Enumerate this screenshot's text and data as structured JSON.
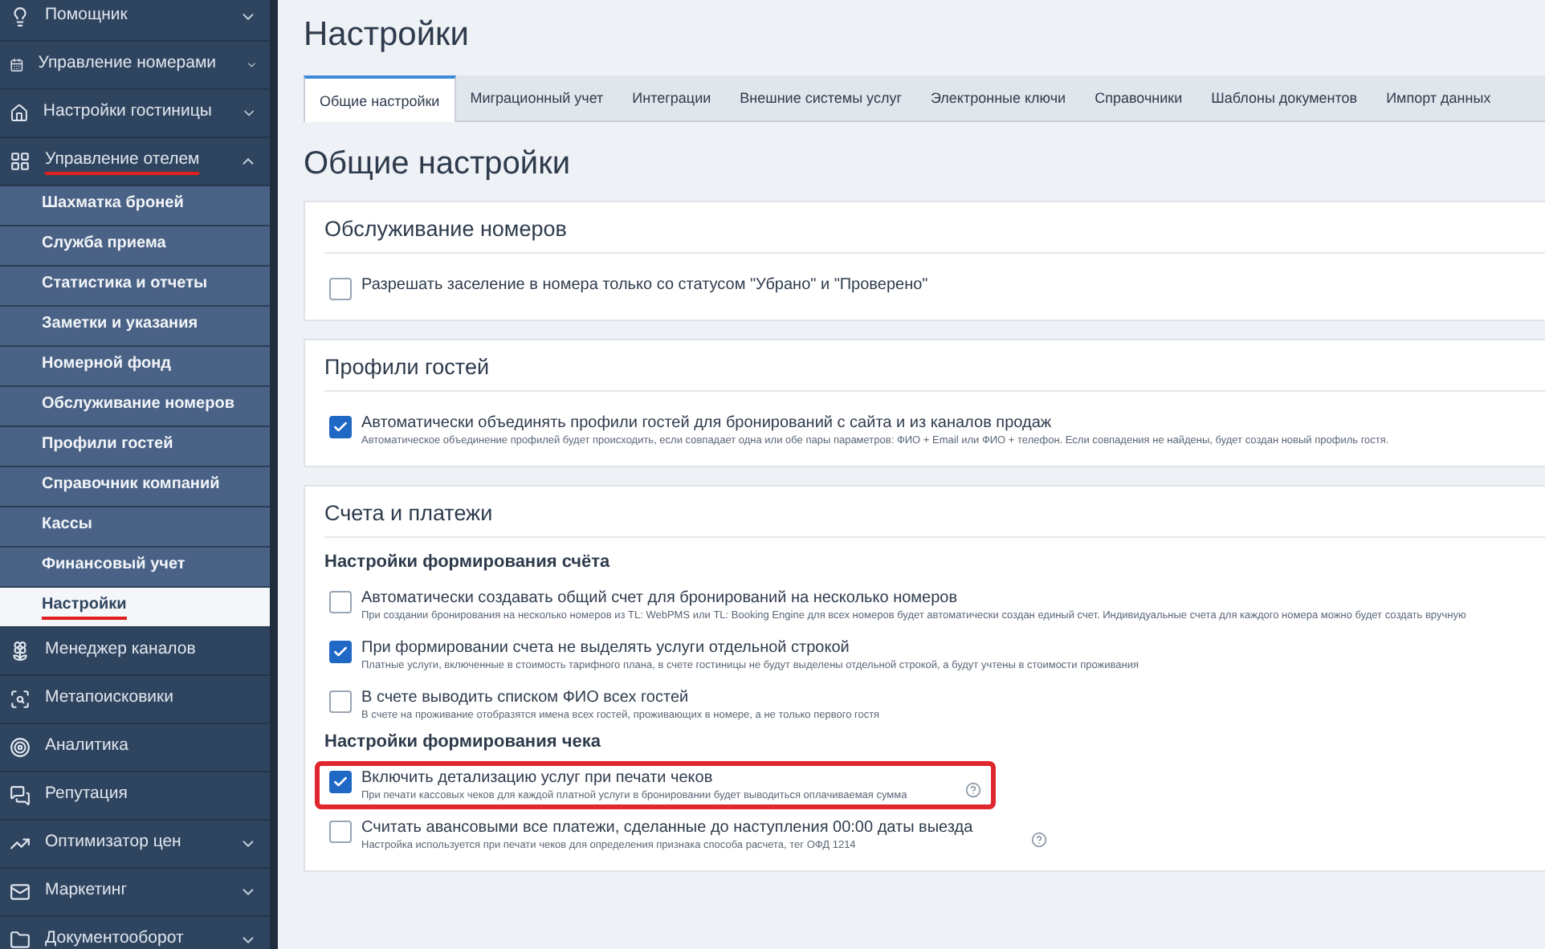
{
  "sidebar": {
    "items": [
      {
        "label": "Помощник",
        "expanded": false,
        "underlined": false
      },
      {
        "label": "Управление номерами",
        "expanded": false,
        "underlined": false
      },
      {
        "label": "Настройки гостиницы",
        "expanded": false,
        "underlined": false
      },
      {
        "label": "Управление отелем",
        "expanded": true,
        "underlined": true,
        "children": [
          {
            "label": "Шахматка броней",
            "selected": false,
            "underlined": false
          },
          {
            "label": "Служба приема",
            "selected": false,
            "underlined": false
          },
          {
            "label": "Статистика и отчеты",
            "selected": false,
            "underlined": false
          },
          {
            "label": "Заметки и указания",
            "selected": false,
            "underlined": false
          },
          {
            "label": "Номерной фонд",
            "selected": false,
            "underlined": false
          },
          {
            "label": "Обслуживание номеров",
            "selected": false,
            "underlined": false
          },
          {
            "label": "Профили гостей",
            "selected": false,
            "underlined": false
          },
          {
            "label": "Справочник компаний",
            "selected": false,
            "underlined": false
          },
          {
            "label": "Кассы",
            "selected": false,
            "underlined": false
          },
          {
            "label": "Финансовый учет",
            "selected": false,
            "underlined": false
          },
          {
            "label": "Настройки",
            "selected": true,
            "underlined": true
          }
        ]
      },
      {
        "label": "Менеджер каналов",
        "underlined": false
      },
      {
        "label": "Метапоисковики",
        "underlined": false
      },
      {
        "label": "Аналитика",
        "underlined": false
      },
      {
        "label": "Репутация",
        "underlined": false
      },
      {
        "label": "Оптимизатор цен",
        "expanded": false,
        "underlined": false
      },
      {
        "label": "Маркетинг",
        "expanded": false,
        "underlined": false
      },
      {
        "label": "Документооборот",
        "expanded": false,
        "underlined": false
      }
    ]
  },
  "page_title": "Настройки",
  "tabs": [
    {
      "label": "Общие настройки",
      "selected": true
    },
    {
      "label": "Миграционный учет",
      "selected": false
    },
    {
      "label": "Интеграции",
      "selected": false
    },
    {
      "label": "Внешние системы услуг",
      "selected": false
    },
    {
      "label": "Электронные ключи",
      "selected": false
    },
    {
      "label": "Справочники",
      "selected": false
    },
    {
      "label": "Шаблоны документов",
      "selected": false
    },
    {
      "label": "Импорт данных",
      "selected": false
    }
  ],
  "section_title": "Общие настройки",
  "cards": [
    {
      "title": "Обслуживание номеров",
      "groups": [
        {
          "options": [
            {
              "label": "Разрешать заселение в номера только со статусом \"Убрано\" и \"Проверено\"",
              "checked": false
            }
          ]
        }
      ]
    },
    {
      "title": "Профили гостей",
      "groups": [
        {
          "options": [
            {
              "label": "Автоматически объединять профили гостей для бронирований с сайта и из каналов продаж",
              "hint": "Автоматическое объединение профилей будет происходить, если совпадает одна или обе пары параметров: ФИО + Email или ФИО + телефон. Если совпадения не найдены, будет создан новый профиль гостя.",
              "checked": true
            }
          ]
        }
      ]
    },
    {
      "title": "Счета и платежи",
      "groups": [
        {
          "subtitle": "Настройки формирования счёта",
          "options": [
            {
              "label": "Автоматически создавать общий счет для бронирований на несколько номеров",
              "hint": "При создании бронирования на несколько номеров из TL: WebPMS или TL: Booking Engine для всех номеров будет автоматически создан единый счет. Индивидуальные счета для каждого номера можно будет создать вручную",
              "checked": false
            },
            {
              "label": "При формировании счета не выделять услуги отдельной строкой",
              "hint": "Платные услуги, включенные в стоимость тарифного плана, в счете гостиницы не будут выделены отдельной строкой, а будут учтены в стоимости проживания",
              "checked": true
            },
            {
              "label": "В счете выводить списком ФИО всех гостей",
              "hint": "В счете на проживание отобразятся имена всех гостей, проживающих в номере, а не только первого гостя",
              "checked": false
            }
          ]
        },
        {
          "subtitle": "Настройки формирования чека",
          "options": [
            {
              "label": "Включить детализацию услуг при печати чеков",
              "hint": "При печати кассовых чеков для каждой платной услуги в бронировании будет выводиться оплачиваемая сумма",
              "checked": true,
              "highlighted": true,
              "help": true
            },
            {
              "label": "Считать авансовыми все платежи, сделанные до наступления 00:00 даты выезда",
              "hint": "Настройка используется при печати чеков для определения признака способа расчета, тег ОФД 1214",
              "checked": false,
              "help": true
            }
          ]
        }
      ]
    }
  ]
}
